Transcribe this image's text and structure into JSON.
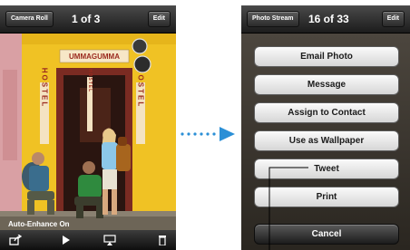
{
  "left_screen": {
    "navbar": {
      "back_label": "Camera Roll",
      "title": "1 of 3",
      "edit_label": "Edit"
    },
    "photo": {
      "sign_top": "UMMAGUMMA",
      "sign_left": "HOSTEL",
      "sign_right": "HOSTEL",
      "sign_door": "HOSTEL"
    },
    "overlay_label": "Auto-Enhance On",
    "toolbar_icons": [
      "share-icon",
      "play-icon",
      "airplay-icon",
      "trash-icon"
    ]
  },
  "right_screen": {
    "navbar": {
      "back_label": "Photo Stream",
      "title": "16 of 33",
      "edit_label": "Edit"
    },
    "actions": [
      {
        "label": "Email Photo"
      },
      {
        "label": "Message"
      },
      {
        "label": "Assign to Contact"
      },
      {
        "label": "Use as Wallpaper"
      },
      {
        "label": "Tweet"
      },
      {
        "label": "Print"
      }
    ],
    "cancel_label": "Cancel"
  },
  "colors": {
    "arrow": "#2b8fd6",
    "wall": "#f0c224",
    "navbar": "#2a2a2a"
  }
}
